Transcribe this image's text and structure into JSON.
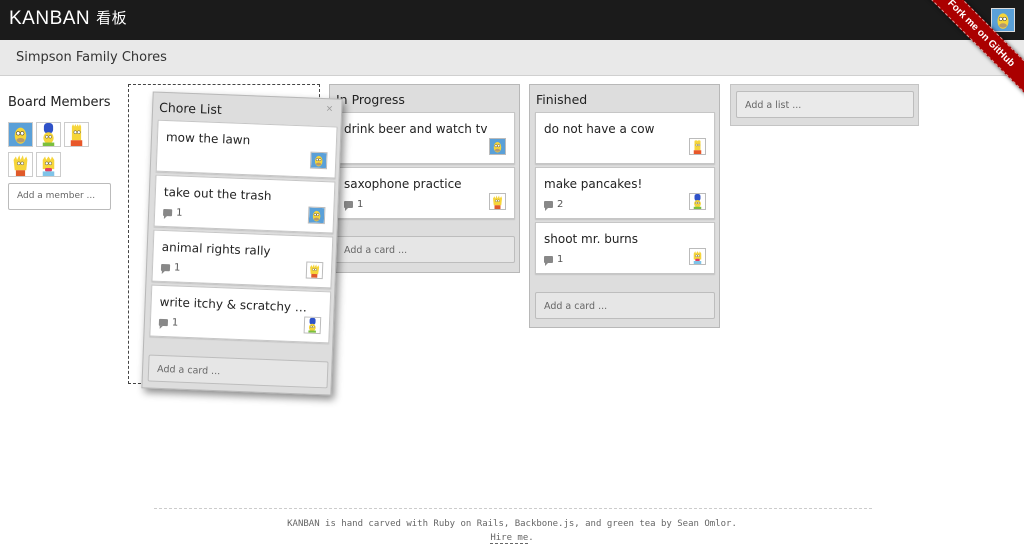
{
  "app": {
    "brand": "KANBAN",
    "brand_cjk": "看板",
    "fork_ribbon": "Fork me on GitHub"
  },
  "board": {
    "title": "Simpson Family Chores"
  },
  "sidebar": {
    "title": "Board Members",
    "members": [
      {
        "icon": "homer-avatar-icon",
        "bg": "#5aa0d8"
      },
      {
        "icon": "marge-avatar-icon",
        "bg": "#ffffff"
      },
      {
        "icon": "bart-avatar-icon",
        "bg": "#ffffff"
      },
      {
        "icon": "lisa-avatar-icon",
        "bg": "#ffffff"
      },
      {
        "icon": "maggie-avatar-icon",
        "bg": "#ffffff"
      }
    ],
    "add_member_placeholder": "Add a member ..."
  },
  "lists": [
    {
      "title": "Chore List",
      "close": "×",
      "cards": [
        {
          "text": "mow the lawn",
          "comments": "",
          "avatar": "homer-avatar-icon"
        },
        {
          "text": "take out the trash",
          "comments": "1",
          "avatar": "homer-avatar-icon"
        },
        {
          "text": "animal rights rally",
          "comments": "1",
          "avatar": "lisa-avatar-icon"
        },
        {
          "text": "write itchy & scratchy c...",
          "comments": "1",
          "avatar": "marge-avatar-icon"
        }
      ],
      "add_card": "Add a card ..."
    },
    {
      "title": "In Progress",
      "cards": [
        {
          "text": "drink beer and watch tv",
          "comments": "",
          "avatar": "homer-avatar-icon"
        },
        {
          "text": "saxophone practice",
          "comments": "1",
          "avatar": "lisa-avatar-icon"
        }
      ],
      "add_card": "Add a card ..."
    },
    {
      "title": "Finished",
      "cards": [
        {
          "text": "do not have a cow",
          "comments": "",
          "avatar": "bart-avatar-icon"
        },
        {
          "text": "make pancakes!",
          "comments": "2",
          "avatar": "marge-avatar-icon"
        },
        {
          "text": "shoot mr. burns",
          "comments": "1",
          "avatar": "maggie-avatar-icon"
        }
      ],
      "add_card": "Add a card ..."
    }
  ],
  "add_list_placeholder": "Add a list ...",
  "footer": {
    "text": "KANBAN is hand carved with Ruby on Rails, Backbone.js, and green tea by Sean Omlor.",
    "link": "Hire me",
    "link_suffix": "."
  },
  "colors": {
    "topbar": "#1b1b1b",
    "ribbon": "#aa0000",
    "simpson_yellow": "#f6d53a",
    "list_bg": "#dddddd"
  }
}
